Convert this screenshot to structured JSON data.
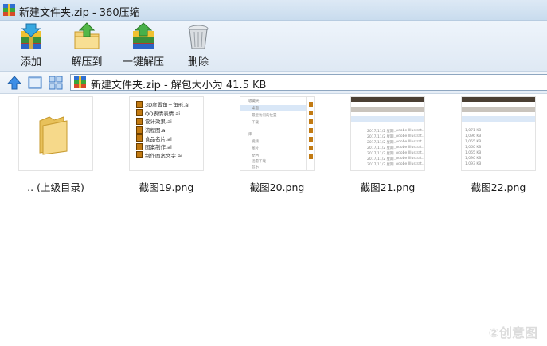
{
  "window": {
    "title": "新建文件夹.zip - 360压缩"
  },
  "toolbar": {
    "add_label": "添加",
    "extract_to_label": "解压到",
    "one_click_extract_label": "一键解压",
    "delete_label": "删除"
  },
  "address": {
    "path": "新建文件夹.zip - 解包大小为 41.5 KB"
  },
  "files": [
    {
      "name": ".. (上级目录)",
      "icon": "folder-icon"
    },
    {
      "name": "截图19.png",
      "icon": "image-thumbnail"
    },
    {
      "name": "截图20.png",
      "icon": "image-thumbnail"
    },
    {
      "name": "截图21.png",
      "icon": "image-thumbnail"
    },
    {
      "name": "截图22.png",
      "icon": "image-thumbnail"
    }
  ],
  "thumb19": {
    "lines": [
      "3D度置角三角形.ai",
      "QQ表情表情.ai",
      "设计效果.ai",
      "流程图.ai",
      "食品名片.ai",
      "图案制作.ai",
      "制作图案文字.ai"
    ]
  },
  "thumb20": {
    "sidebar": [
      "收藏夹",
      "桌面",
      "最近访问的位置",
      "下载",
      "库",
      "视频",
      "图片",
      "文档",
      "迅雷下载",
      "音乐"
    ]
  },
  "thumb21": {
    "rows": [
      "2017/11/2 星期...",
      "2017/11/2 星期...",
      "2017/11/2 星期...",
      "2017/11/2 星期...",
      "2017/11/2 星期...",
      "2017/11/2 星期...",
      "2017/11/2 星期..."
    ],
    "type": "Adobe Illustrat..."
  },
  "thumb22": {
    "sizes": [
      "1,071 KB",
      "1,096 KB",
      "1,055 KB",
      "1,060 KB",
      "1,065 KB",
      "1,090 KB",
      "1,093 KB"
    ]
  },
  "watermark": "②创意图"
}
